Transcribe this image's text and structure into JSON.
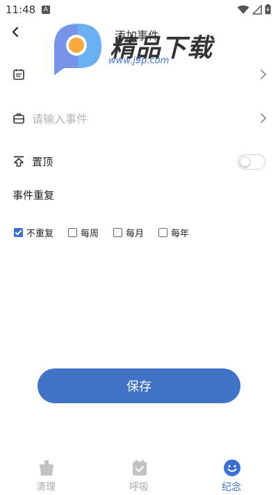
{
  "status_bar": {
    "time": "11:48",
    "a_badge": "A"
  },
  "nav": {
    "title": "添加事件"
  },
  "watermark": {
    "brand": "精品下载",
    "url": "www.j9p.com"
  },
  "form": {
    "date_value": "",
    "event_placeholder": "请输入事件",
    "pin_label": "置顶",
    "pin_on": false,
    "repeat_title": "事件重复",
    "repeat_options": [
      {
        "label": "不重复",
        "checked": true
      },
      {
        "label": "每周",
        "checked": false
      },
      {
        "label": "每月",
        "checked": false
      },
      {
        "label": "每年",
        "checked": false
      }
    ]
  },
  "save_label": "保存",
  "tabs": [
    {
      "label": "清理",
      "icon": "cleanup-icon",
      "active": false
    },
    {
      "label": "呼吸",
      "icon": "breath-icon",
      "active": false
    },
    {
      "label": "纪念",
      "icon": "smile-icon",
      "active": true
    }
  ],
  "colors": {
    "accent": "#3b6fd8",
    "save_button": "#3f73c7",
    "inactive": "#aaaaaa"
  }
}
